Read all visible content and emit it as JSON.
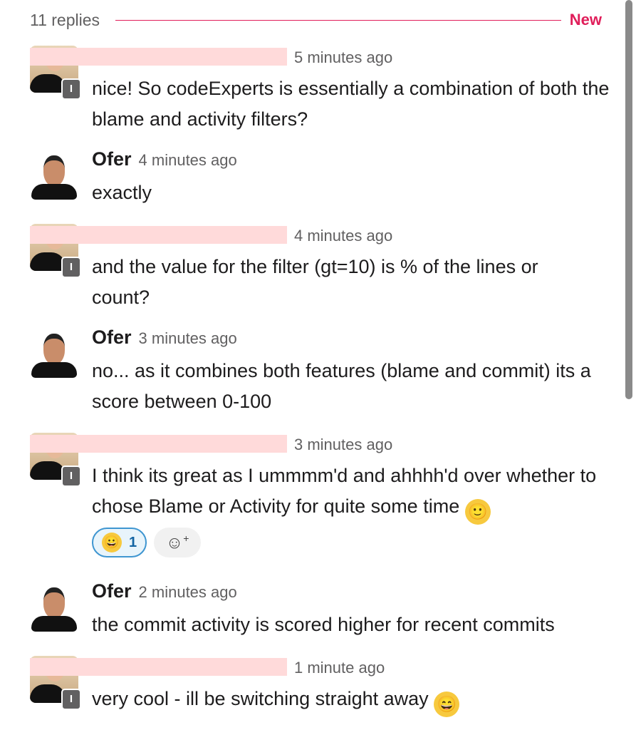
{
  "thread": {
    "reply_count": "11 replies",
    "new_label": "New"
  },
  "messages": [
    {
      "author": "",
      "time": "5 minutes ago",
      "text": "nice! So codeExperts is essentially a combination of both the blame and activity filters?",
      "badge": "I"
    },
    {
      "author": "Ofer",
      "time": "4 minutes ago",
      "text": "exactly"
    },
    {
      "author": "",
      "time": "4 minutes ago",
      "text": "and the value for the filter (gt=10) is % of the lines or count?",
      "badge": "I"
    },
    {
      "author": "Ofer",
      "time": "3 minutes ago",
      "text": "no... as it combines both features (blame and commit) its a score between 0-100"
    },
    {
      "author": "",
      "time": "3 minutes ago",
      "text": "I think its great as I ummmm'd and ahhhh'd over whether to chose Blame or Activity for quite some time",
      "emoji": "🙂",
      "badge": "I",
      "reaction": {
        "emoji": "😀",
        "count": "1"
      }
    },
    {
      "author": "Ofer",
      "time": "2 minutes ago",
      "text": "the commit activity is scored higher for recent commits"
    },
    {
      "author": "",
      "time": "1 minute ago",
      "text": "very cool - ill be switching straight away",
      "emoji": "😄",
      "badge": "I"
    }
  ]
}
